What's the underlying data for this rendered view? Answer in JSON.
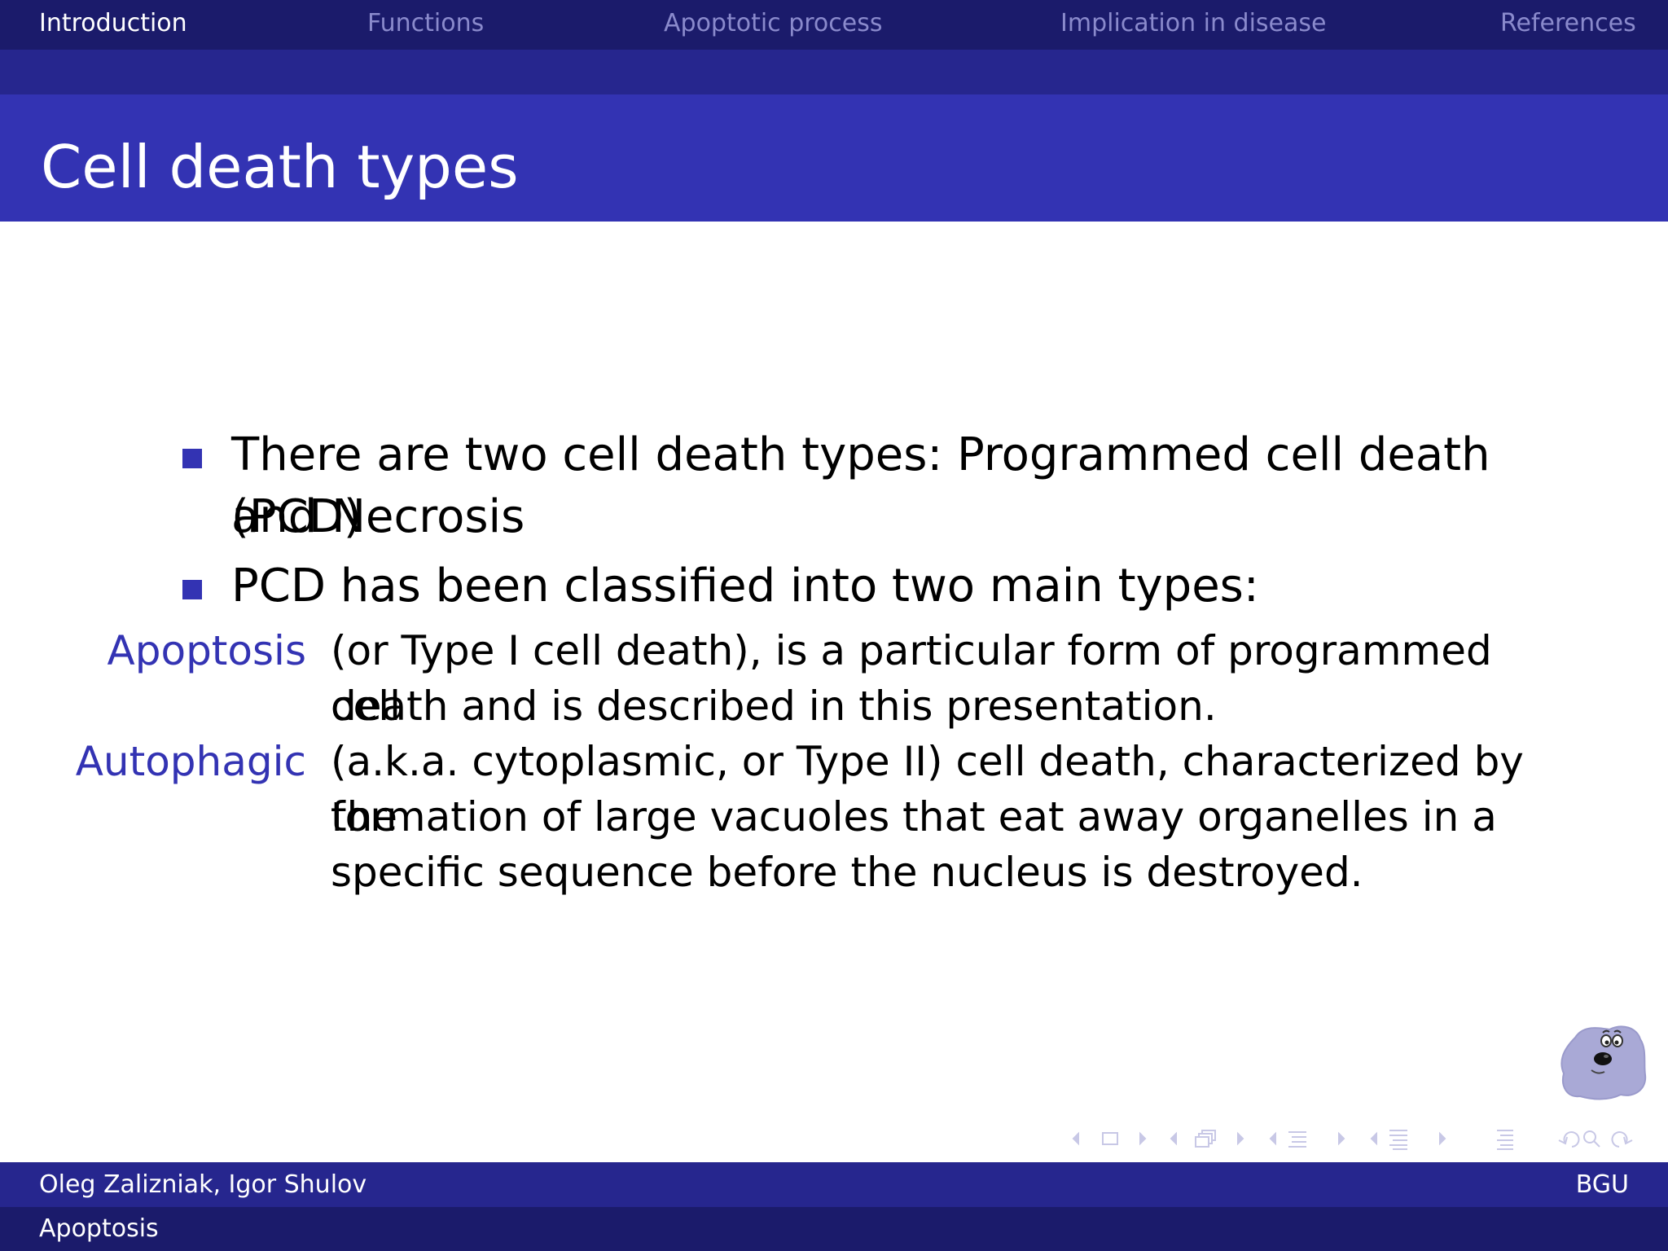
{
  "nav": {
    "items": [
      {
        "label": "Introduction",
        "active": true
      },
      {
        "label": "Functions",
        "active": false
      },
      {
        "label": "Apoptotic process",
        "active": false
      },
      {
        "label": "Implication in disease",
        "active": false
      },
      {
        "label": "References",
        "active": false
      }
    ]
  },
  "slide": {
    "title": "Cell death types",
    "bullets": [
      {
        "line1": "There are two cell death types: Programmed cell death (PCD)",
        "line2": "and Necrosis"
      },
      {
        "line1": "PCD has been classified into two main types:"
      }
    ],
    "descriptions": [
      {
        "term": "Apoptosis",
        "lines": [
          "(or Type I cell death), is a particular form of programmed cell",
          "death and is described in this presentation."
        ]
      },
      {
        "term": "Autophagic",
        "lines": [
          "(a.k.a. cytoplasmic, or Type II) cell death, characterized by the",
          "formation of large vacuoles that eat away organelles in a",
          "specific sequence before the nucleus is destroyed."
        ]
      }
    ]
  },
  "footer": {
    "authors": "Oleg Zalizniak, Igor Shulov",
    "institution": "BGU",
    "short_title": "Apoptosis"
  },
  "colors": {
    "nav_bg": "#1b1b6b",
    "subbar_bg": "#26268e",
    "title_bg": "#3333b3",
    "accent": "#3333b3",
    "nav_inactive": "#8a8acc",
    "nav_symbol": "#c8c8e6"
  },
  "icons": {
    "nav_symbols": [
      "slide-prev-arrow-icon",
      "slide-frame-icon",
      "slide-next-arrow-icon",
      "frame-prev-arrow-icon",
      "frame-stack-icon",
      "frame-next-arrow-icon",
      "subsection-prev-arrow-icon",
      "subsection-icon",
      "subsection-next-arrow-icon",
      "section-prev-arrow-icon",
      "section-icon",
      "section-next-arrow-icon",
      "document-icon",
      "back-icon",
      "search-icon",
      "forward-icon"
    ],
    "mascot": "blob-mascot-icon"
  }
}
